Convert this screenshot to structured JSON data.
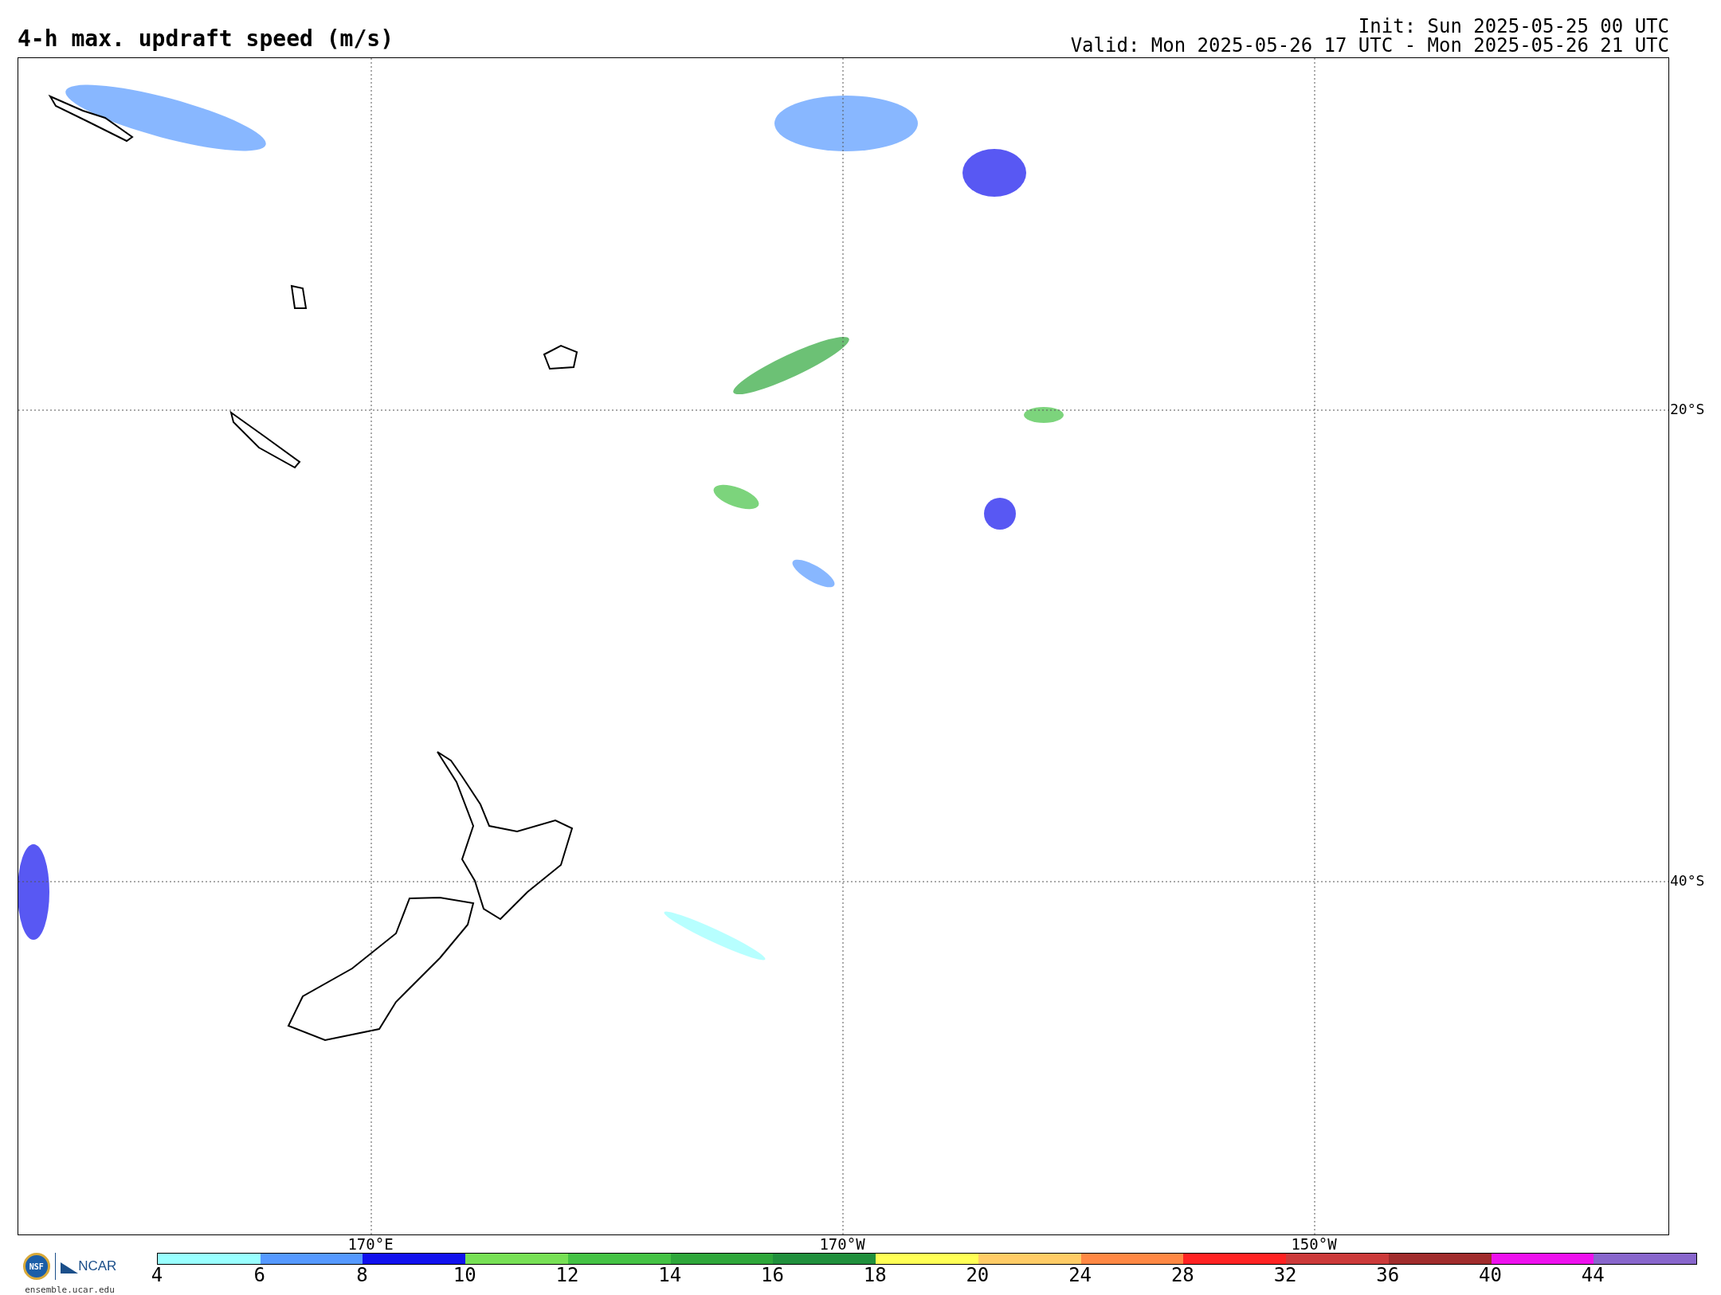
{
  "title": "4-h max. updraft speed (m/s)",
  "init": "Init: Sun 2025-05-25 00 UTC",
  "valid": "Valid: Mon 2025-05-26 17 UTC - Mon 2025-05-26 21 UTC",
  "map": {
    "lat_labels": [
      "20°S",
      "40°S"
    ],
    "lon_labels": [
      "170°E",
      "170°W",
      "150°W"
    ]
  },
  "logos": {
    "nsf": "NSF",
    "ncar": "NCAR",
    "site": "ensemble.ucar.edu"
  },
  "colorbar": {
    "segments": [
      {
        "color": "#99ffff"
      },
      {
        "color": "#5599ff"
      },
      {
        "color": "#1111ee"
      },
      {
        "color": "#77e055"
      },
      {
        "color": "#44c244"
      },
      {
        "color": "#2ea63a"
      },
      {
        "color": "#208f3c"
      },
      {
        "color": "#ffff55"
      },
      {
        "color": "#ffcc66"
      },
      {
        "color": "#ff8844"
      },
      {
        "color": "#ff2222"
      },
      {
        "color": "#cc3a3a"
      },
      {
        "color": "#a02c2c"
      },
      {
        "color": "#ee11ee"
      },
      {
        "color": "#8866cc"
      }
    ],
    "ticks": [
      "4",
      "6",
      "8",
      "10",
      "12",
      "14",
      "16",
      "18",
      "20",
      "24",
      "28",
      "32",
      "36",
      "40",
      "44"
    ]
  }
}
